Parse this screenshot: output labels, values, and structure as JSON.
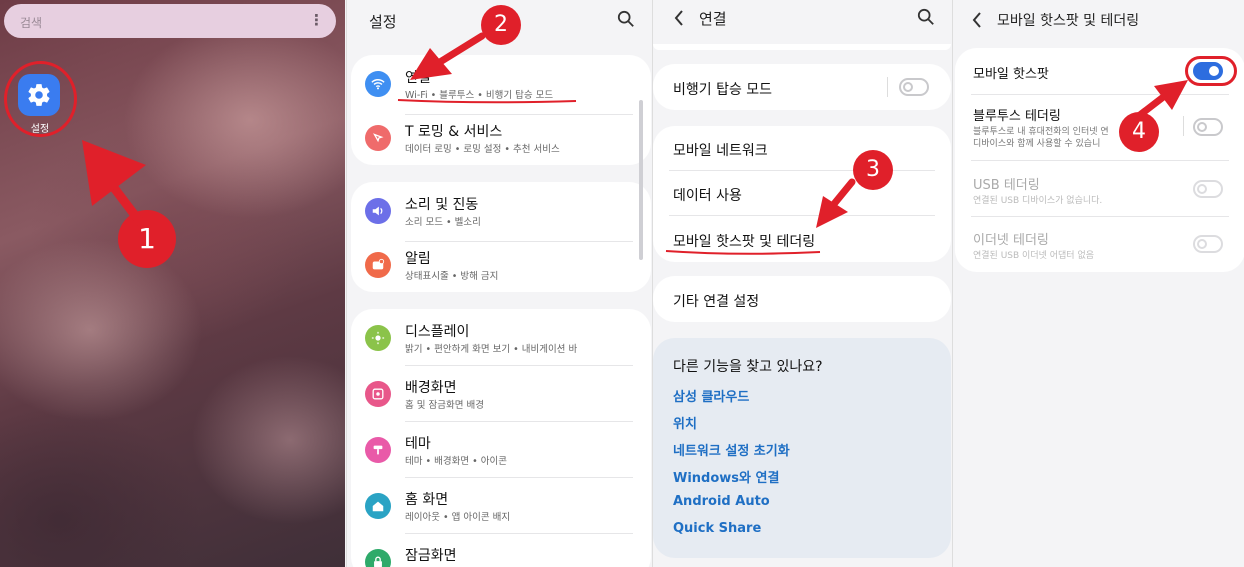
{
  "home": {
    "search_placeholder": "검색",
    "app_label": "설정"
  },
  "settings": {
    "title": "설정",
    "items": [
      {
        "title": "연결",
        "sub": "Wi-Fi • 블루투스 • 비행기 탑승 모드"
      },
      {
        "title": "T 로밍 & 서비스",
        "sub": "데이터 로밍 • 로밍 설정 • 추천 서비스"
      },
      {
        "title": "소리 및 진동",
        "sub": "소리 모드 • 벨소리"
      },
      {
        "title": "알림",
        "sub": "상태표시줄 • 방해 금지"
      },
      {
        "title": "디스플레이",
        "sub": "밝기 • 편안하게 화면 보기 • 내비게이션 바"
      },
      {
        "title": "배경화면",
        "sub": "홈 및 잠금화면 배경"
      },
      {
        "title": "테마",
        "sub": "테마 • 배경화면 • 아이콘"
      },
      {
        "title": "홈 화면",
        "sub": "레이아웃 • 앱 아이콘 배지"
      },
      {
        "title": "잠금화면",
        "sub": ""
      }
    ]
  },
  "connections": {
    "title": "연결",
    "airplane": "비행기 탑승 모드",
    "mobile_network": "모바일 네트워크",
    "data_usage": "데이터 사용",
    "hotspot_tethering": "모바일 핫스팟 및 테더링",
    "more_settings": "기타 연결 설정",
    "suggest_title": "다른 기능을 찾고 있나요?",
    "suggest_links": [
      "삼성 클라우드",
      "위치",
      "네트워크 설정 초기화",
      "Windows와 연결",
      "Android Auto",
      "Quick Share"
    ]
  },
  "hotspot": {
    "title": "모바일 핫스팟 및 테더링",
    "mobile_hotspot": "모바일 핫스팟",
    "bt_tethering": "블루투스 테더링",
    "bt_sub1": "블루투스로 내 휴대전화의 인터넷 연",
    "bt_sub2": "디바이스와 함께 사용할 수 있습니",
    "usb_tethering": "USB 테더링",
    "usb_sub": "연결된 USB 디바이스가 없습니다.",
    "eth_tethering": "이더넷 테더링",
    "eth_sub": "연결된 USB 이더넷 어댑터 없음"
  },
  "steps": [
    "1",
    "2",
    "3",
    "4"
  ],
  "colors": {
    "accent": "#2d6ddf",
    "annotation": "#e0202a",
    "link": "#1f6fc4"
  }
}
